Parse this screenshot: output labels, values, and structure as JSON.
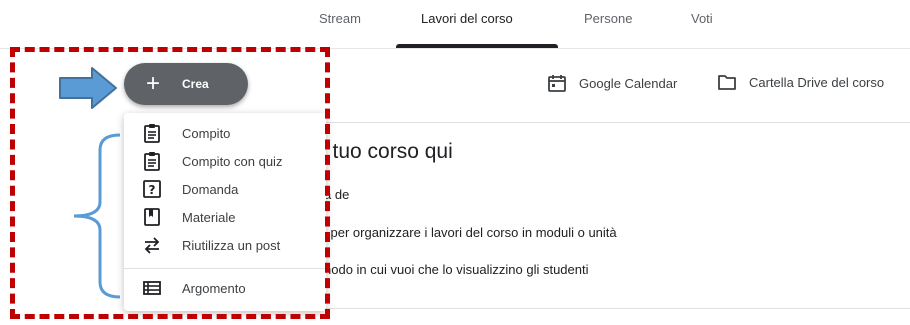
{
  "tabs": [
    {
      "label": "Stream",
      "active": false
    },
    {
      "label": "Lavori del corso",
      "active": true
    },
    {
      "label": "Persone",
      "active": false
    },
    {
      "label": "Voti",
      "active": false
    }
  ],
  "header_links": {
    "calendar": {
      "label": "Google Calendar",
      "icon": "calendar-icon"
    },
    "drive": {
      "label": "Cartella Drive del corso",
      "icon": "folder-icon"
    }
  },
  "create_button": {
    "label": "Crea",
    "icon": "plus-icon"
  },
  "menu": {
    "items": [
      {
        "label": "Compito",
        "icon": "assignment-icon"
      },
      {
        "label": "Compito con quiz",
        "icon": "quiz-assignment-icon"
      },
      {
        "label": "Domanda",
        "icon": "question-icon"
      },
      {
        "label": "Materiale",
        "icon": "material-icon"
      },
      {
        "label": "Riutilizza un post",
        "icon": "reuse-icon"
      }
    ],
    "topic": {
      "label": "Argomento",
      "icon": "topic-icon"
    }
  },
  "content": {
    "title": "l tuo corso qui",
    "lines": [
      "a de",
      "i per organizzare i lavori del corso in moduli o unità",
      "nodo in cui vuoi che lo visualizzino gli studenti"
    ]
  },
  "colors": {
    "annotation_red": "#c00000",
    "annotation_blue": "#5b9bd5",
    "create_button_bg": "#5f6368"
  }
}
